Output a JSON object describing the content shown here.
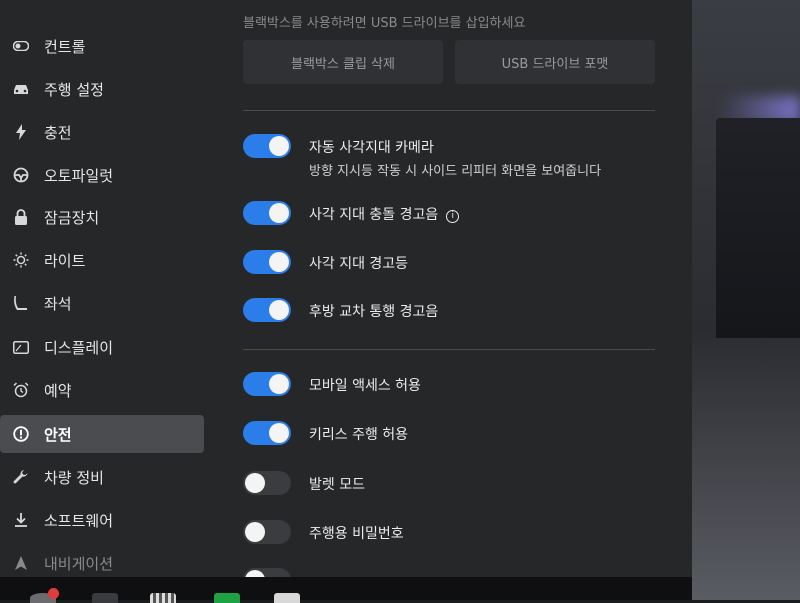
{
  "sidebar": {
    "items": [
      {
        "label": "컨트롤",
        "icon": "toggle-icon"
      },
      {
        "label": "주행 설정",
        "icon": "car-icon"
      },
      {
        "label": "충전",
        "icon": "bolt-icon"
      },
      {
        "label": "오토파일럿",
        "icon": "steering-wheel-icon"
      },
      {
        "label": "잠금장치",
        "icon": "lock-icon"
      },
      {
        "label": "라이트",
        "icon": "sun-icon"
      },
      {
        "label": "좌석",
        "icon": "seat-icon"
      },
      {
        "label": "디스플레이",
        "icon": "display-icon"
      },
      {
        "label": "예약",
        "icon": "alarm-clock-icon"
      },
      {
        "label": "안전",
        "icon": "alert-circle-icon",
        "active": true
      },
      {
        "label": "차량 정비",
        "icon": "wrench-icon"
      },
      {
        "label": "소프트웨어",
        "icon": "download-icon"
      },
      {
        "label": "내비게이션",
        "icon": "navigation-arrow-icon"
      }
    ]
  },
  "dashcam": {
    "hint": "블랙박스를 사용하려면 USB 드라이브를 삽입하세요",
    "delete_clips_label": "블랙박스 클립 삭제",
    "format_usb_label": "USB 드라이브 포맷"
  },
  "settings": {
    "blind_spot_camera": {
      "label": "자동 사각지대 카메라",
      "sub": "방향 지시등 작동 시 사이드 리피터 화면을 보여줍니다",
      "on": true
    },
    "blind_spot_chime": {
      "label": "사각 지대 충돌 경고음",
      "on": true
    },
    "blind_spot_light": {
      "label": "사각 지대 경고등",
      "on": true
    },
    "rear_cross_traffic": {
      "label": "후방 교차 통행 경고음",
      "on": true
    },
    "mobile_access": {
      "label": "모바일 액세스 허용",
      "on": true
    },
    "keyless_driving": {
      "label": "키리스 주행 허용",
      "on": true
    },
    "valet_mode": {
      "label": "발렛 모드",
      "on": false
    },
    "pin_to_drive": {
      "label": "주행용 비밀번호",
      "on": false
    }
  },
  "colors": {
    "toggle_on": "#2b7de9",
    "toggle_off": "#3b3c40",
    "background": "#262729",
    "active_item": "#4b4c50"
  }
}
